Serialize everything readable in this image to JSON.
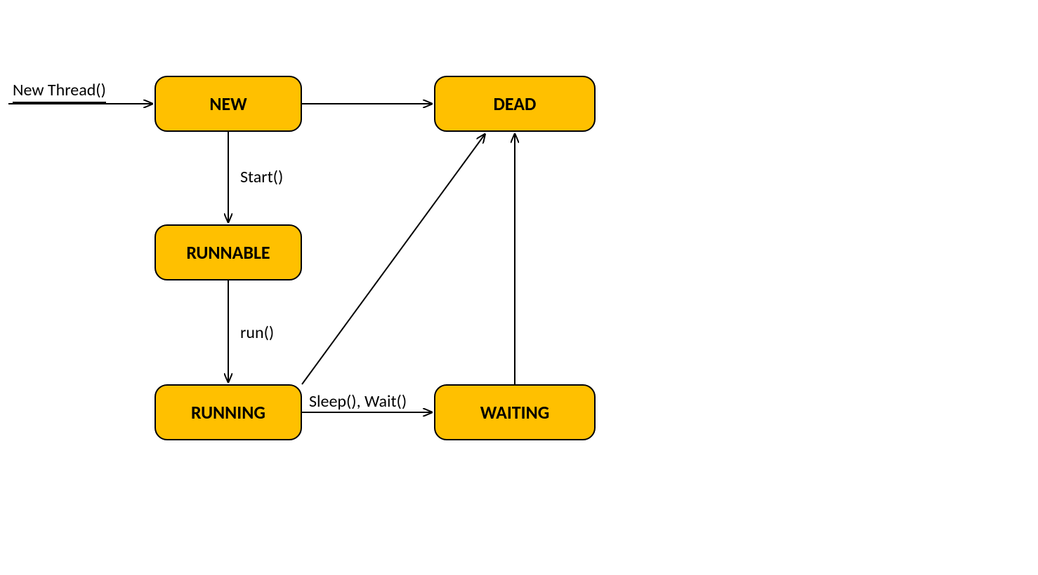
{
  "nodes": {
    "new": {
      "label": "NEW"
    },
    "dead": {
      "label": "DEAD"
    },
    "runnable": {
      "label": "RUNNABLE"
    },
    "running": {
      "label": "RUNNING"
    },
    "waiting": {
      "label": "WAITING"
    }
  },
  "edges": {
    "entry": {
      "label": "New Thread()"
    },
    "new_to_runnable": {
      "label": "Start()"
    },
    "runnable_to_running": {
      "label": "run()"
    },
    "running_to_waiting": {
      "label": "Sleep(), Wait()"
    }
  },
  "colors": {
    "node_fill": "#ffc000",
    "node_stroke": "#000000",
    "arrow": "#000000"
  }
}
